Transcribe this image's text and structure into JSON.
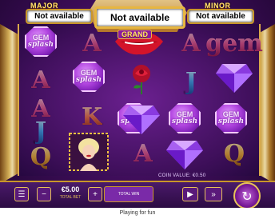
{
  "jackpots": {
    "major": {
      "label": "MAJOR",
      "value": "Not available"
    },
    "grand": {
      "label": "GRAND",
      "value": "Not available"
    },
    "minor": {
      "label": "MINOR",
      "value": "Not available"
    }
  },
  "reels": [
    [
      "gem",
      "A",
      "A",
      "J",
      "Q"
    ],
    [
      "A",
      "gem",
      "K",
      "Marilyn",
      "diamond"
    ],
    [
      "lips",
      "rose",
      "gem",
      "A",
      "gem"
    ],
    [
      "A",
      "J",
      "diamond",
      "gem",
      "Q"
    ],
    [
      "diamond",
      "gem",
      "diamond",
      "Q",
      "diamond"
    ]
  ],
  "gem_symbol": {
    "line1": "GEM",
    "line2": "splash"
  },
  "controls": {
    "stake_value": "€5.00",
    "stake_label": "TOTAL BET",
    "total_win_label": "TOTAL WIN",
    "win_limit_text": "COIN VALUE: €0.50",
    "minus": "−",
    "plus": "+"
  },
  "footer": {
    "text": "Playing for fun"
  },
  "colors": {
    "accent_gold": "#e7c25a",
    "background_purple": "#3a0c55"
  }
}
